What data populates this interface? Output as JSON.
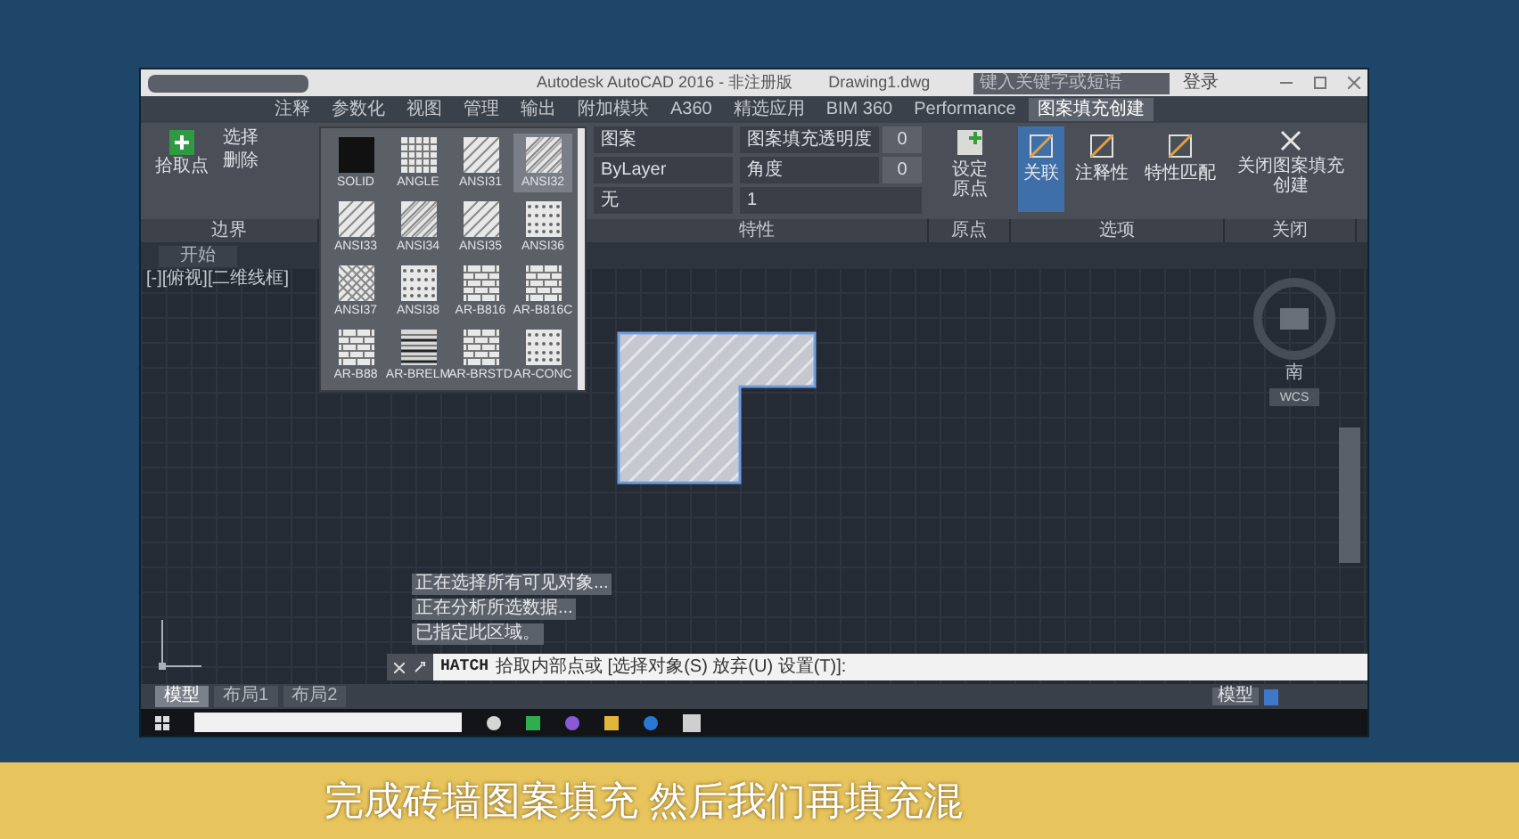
{
  "window": {
    "app_title": "Autodesk AutoCAD 2016 - 非注册版",
    "file_name": "Drawing1.dwg",
    "search_placeholder": "键入关键字或短语",
    "login": "登录"
  },
  "ribbon_tabs": [
    {
      "label": "注释",
      "selected": false
    },
    {
      "label": "参数化",
      "selected": false
    },
    {
      "label": "视图",
      "selected": false
    },
    {
      "label": "管理",
      "selected": false
    },
    {
      "label": "输出",
      "selected": false
    },
    {
      "label": "附加模块",
      "selected": false
    },
    {
      "label": "A360",
      "selected": false
    },
    {
      "label": "精选应用",
      "selected": false
    },
    {
      "label": "BIM 360",
      "selected": false
    },
    {
      "label": "Performance",
      "selected": false
    },
    {
      "label": "图案填充创建",
      "selected": true
    }
  ],
  "boundary_panel": {
    "pick_points": "拾取点",
    "select": "选择",
    "remove": "删除",
    "title": "边界"
  },
  "pattern_gallery": [
    {
      "name": "SOLID",
      "kind": "solid",
      "selected": false
    },
    {
      "name": "ANGLE",
      "kind": "grid",
      "selected": false
    },
    {
      "name": "ANSI31",
      "kind": "diagonal",
      "selected": false
    },
    {
      "name": "ANSI32",
      "kind": "double",
      "selected": true
    },
    {
      "name": "ANSI33",
      "kind": "diagonal",
      "selected": false
    },
    {
      "name": "ANSI34",
      "kind": "double",
      "selected": false
    },
    {
      "name": "ANSI35",
      "kind": "diagonal",
      "selected": false
    },
    {
      "name": "ANSI36",
      "kind": "dots",
      "selected": false
    },
    {
      "name": "ANSI37",
      "kind": "cross",
      "selected": false
    },
    {
      "name": "ANSI38",
      "kind": "dots",
      "selected": false
    },
    {
      "name": "AR-B816",
      "kind": "brick",
      "selected": false
    },
    {
      "name": "AR-B816C",
      "kind": "brick",
      "selected": false
    },
    {
      "name": "AR-B88",
      "kind": "brick",
      "selected": false
    },
    {
      "name": "AR-BRELM",
      "kind": "lines",
      "selected": false
    },
    {
      "name": "AR-BRSTD",
      "kind": "brick",
      "selected": false
    },
    {
      "name": "AR-CONC",
      "kind": "dots",
      "selected": false
    }
  ],
  "properties_panel": {
    "type": "图案",
    "layer_value": "ByLayer",
    "background": "无",
    "transparency_label": "图案填充透明度",
    "transparency": "0",
    "angle_label": "角度",
    "angle": "0",
    "scale": "1",
    "title": "特性"
  },
  "origin_panel": {
    "set_origin": "设定原点",
    "title": "原点"
  },
  "options_panel": {
    "buttons": [
      {
        "label": "关联",
        "selected": true
      },
      {
        "label": "注释性",
        "selected": false
      },
      {
        "label": "特性匹配",
        "selected": false
      }
    ],
    "title": "选项"
  },
  "close_panel": {
    "button": "关闭图案填充创建",
    "title": "关闭"
  },
  "file_tab": "开始",
  "viewport_label": "[-][俯视][二维线框]",
  "viewcube": {
    "direction": "南",
    "ucs": "WCS"
  },
  "command_history": [
    "正在选择所有可见对象...",
    "正在分析所选数据...",
    "已指定此区域。"
  ],
  "command_line": {
    "command": "HATCH",
    "text": "拾取内部点或 [选择对象(S) 放弃(U) 设置(T)]:"
  },
  "layout_tabs": [
    {
      "label": "模型",
      "selected": true
    },
    {
      "label": "布局1",
      "selected": false
    },
    {
      "label": "布局2",
      "selected": false
    }
  ],
  "status_bar": {
    "space": "模型"
  },
  "subtitle": "完成砖墙图案填充 然后我们再填充混"
}
